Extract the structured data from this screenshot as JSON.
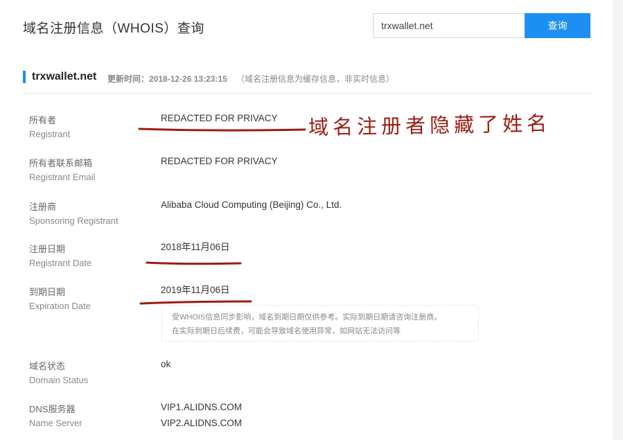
{
  "header": {
    "title": "域名注册信息（WHOIS）查询",
    "search_value": "trxwallet.net",
    "search_button_label": "查询"
  },
  "domain": {
    "name": "trxwallet.net",
    "update_label": "更新时间：2018-12-26 13:23:15",
    "update_note": "（域名注册信息为缓存信息，非实时信息）"
  },
  "rows": [
    {
      "label_cn": "所有者",
      "label_en": "Registrant",
      "value": "REDACTED FOR PRIVACY"
    },
    {
      "label_cn": "所有者联系邮箱",
      "label_en": "Registrant Email",
      "value": "REDACTED FOR PRIVACY"
    },
    {
      "label_cn": "注册商",
      "label_en": "Sponsoring Registrant",
      "value": "Alibaba Cloud Computing (Beijing) Co., Ltd."
    },
    {
      "label_cn": "注册日期",
      "label_en": "Registrant Date",
      "value": "2018年11月06日"
    },
    {
      "label_cn": "到期日期",
      "label_en": "Expiration Date",
      "value": "2019年11月06日"
    },
    {
      "label_cn": "域名状态",
      "label_en": "Domain Status",
      "value": "ok"
    },
    {
      "label_cn": "DNS服务器",
      "label_en": "Name Server",
      "value": "VIP1.ALIDNS.COM",
      "value2": "VIP2.ALIDNS.COM"
    }
  ],
  "notice": {
    "line1": "受WHOIS信息同步影响，域名到期日期仅供参考。实际到期日期请咨询注册商。",
    "line2": "在实际到期日后续费，可能会导致域名使用异常，如网站无法访问等"
  },
  "annotation": {
    "text": "域名注册者隐藏了姓名",
    "color": "#9b1c12"
  },
  "colors": {
    "accent": "#1e8ff2"
  }
}
